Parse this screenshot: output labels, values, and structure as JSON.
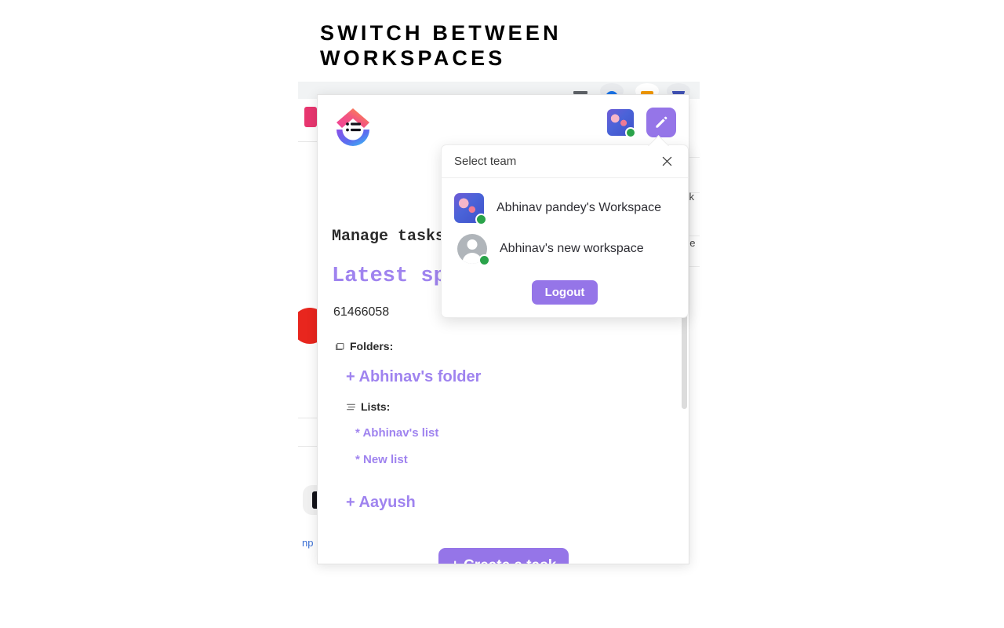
{
  "headline": "Switch between\nworkspaces",
  "browser_toolbar": {
    "icons": [
      "minimize-icon",
      "extension-blue-icon",
      "extension-orange-icon",
      "extension-purple-icon"
    ]
  },
  "background_page": {
    "right_text_1": "ck",
    "right_text_2": "ge",
    "bottom_left_text": "np"
  },
  "extension": {
    "logo_name": "clickup-logo",
    "header": {
      "avatar_name": "user-avatar",
      "status": "online",
      "edit_button_label": "edit",
      "edit_icon": "pencil-icon"
    },
    "manage_title": "Manage tasks",
    "space_title": "Latest sp",
    "space_id": "61466058",
    "folders_label": "Folders:",
    "folders_icon": "folder-icon",
    "folders": [
      {
        "label": "+ Abhinav's folder"
      }
    ],
    "lists_label": "Lists:",
    "lists_icon": "list-icon",
    "lists": [
      {
        "label": "* Abhinav's list"
      },
      {
        "label": "* New list"
      }
    ],
    "second_folder": "+ Aayush",
    "create_task_label": "+ Create a task"
  },
  "team_popup": {
    "title": "Select team",
    "close_icon": "close-icon",
    "teams": [
      {
        "name": "Abhinav pandey's Workspace",
        "avatar": "pixel-avatar",
        "status": "online"
      },
      {
        "name": "Abhinav's new workspace",
        "avatar": "default-person-avatar",
        "status": "online"
      }
    ],
    "logout_label": "Logout"
  },
  "colors": {
    "accent_purple": "#9575e8",
    "text_purple": "#9f83ef",
    "status_green": "#2aa34a",
    "headline_black": "#000000"
  }
}
